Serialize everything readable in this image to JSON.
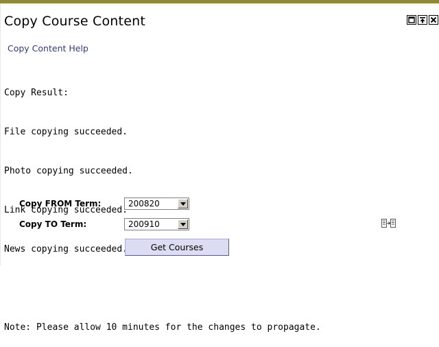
{
  "window": {
    "title": "Copy Course Content",
    "controls": [
      "restore-icon",
      "move-top-icon",
      "close-icon"
    ]
  },
  "help_link": "Copy Content Help",
  "result": {
    "heading": "Copy Result:",
    "lines": [
      "File copying succeeded.",
      "Photo copying succeeded.",
      "Link copying succeeded.",
      "News copying succeeded."
    ],
    "note": "Note: Please allow 10 minutes for the changes to propagate."
  },
  "form": {
    "from_label": "Copy FROM Term:",
    "from_value": "200820",
    "to_label": "Copy TO Term:",
    "to_value": "200910",
    "get_courses_label": "Get Courses",
    "copy_icon": "copy-to-icon"
  },
  "colors": {
    "top_bar": "#8d8a3a",
    "link": "#2f3a78",
    "button_bg": "#dcdcf2"
  }
}
